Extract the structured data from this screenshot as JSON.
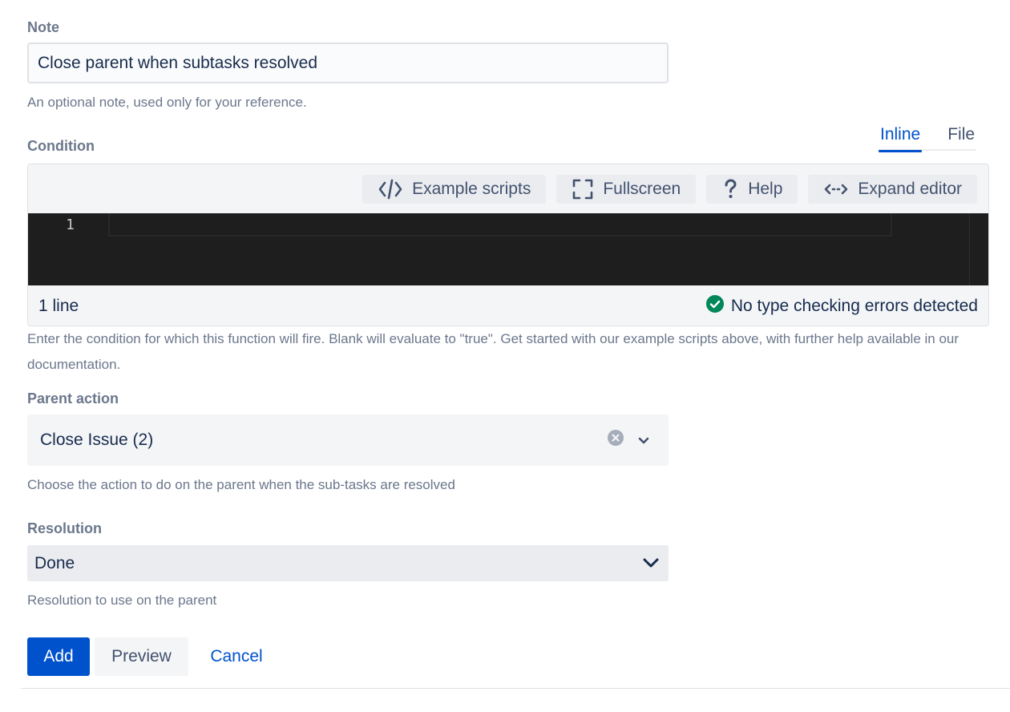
{
  "note": {
    "label": "Note",
    "value": "Close parent when subtasks resolved",
    "help": "An optional note, used only for your reference."
  },
  "condition": {
    "label": "Condition",
    "tabs": [
      {
        "label": "Inline",
        "active": true
      },
      {
        "label": "File",
        "active": false
      }
    ],
    "toolbar": {
      "example_scripts": "Example scripts",
      "fullscreen": "Fullscreen",
      "help": "Help",
      "expand_editor": "Expand editor"
    },
    "editor": {
      "line_numbers": [
        "1"
      ],
      "line_count": "1 line",
      "status": "No type checking errors detected",
      "status_color": "#00875a"
    },
    "help": "Enter the condition for which this function will fire. Blank will evaluate to \"true\". Get started with our example scripts above, with further help available in our documentation."
  },
  "parent_action": {
    "label": "Parent action",
    "value": "Close Issue (2)",
    "help": "Choose the action to do on the parent when the sub-tasks are resolved"
  },
  "resolution": {
    "label": "Resolution",
    "value": "Done",
    "help": "Resolution to use on the parent"
  },
  "actions": {
    "add": "Add",
    "preview": "Preview",
    "cancel": "Cancel"
  },
  "colors": {
    "primary": "#0052cc",
    "text": "#172b4d",
    "subtle": "#6b778c",
    "editor_bg": "#1e1e1e",
    "success": "#00875a"
  },
  "icons": {
    "example_scripts": "code-icon",
    "fullscreen": "fullscreen-icon",
    "help": "question-icon",
    "expand_editor": "expand-arrows-icon",
    "status": "check-circle-icon",
    "clear": "clear-circle-icon",
    "dropdown": "chevron-down-icon"
  }
}
